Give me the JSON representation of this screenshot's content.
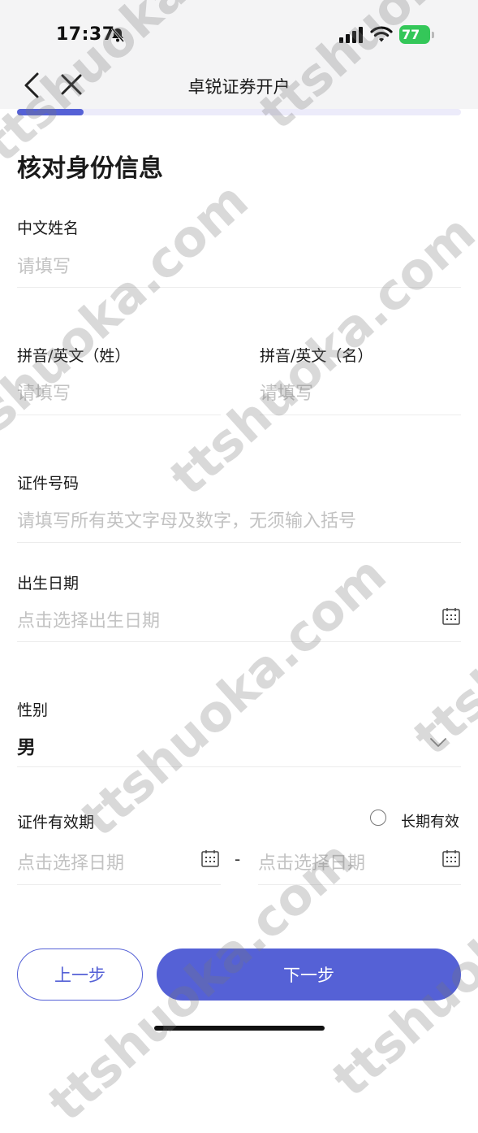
{
  "status_bar": {
    "time": "17:37",
    "battery": "77"
  },
  "nav": {
    "title": "卓锐证券开户"
  },
  "progress": {
    "fraction": 0.15
  },
  "page_title": "核对身份信息",
  "form": {
    "chinese_name": {
      "label": "中文姓名",
      "placeholder": "请填写"
    },
    "pinyin_surname": {
      "label": "拼音/英文（姓）",
      "placeholder": "请填写"
    },
    "pinyin_given": {
      "label": "拼音/英文（名）",
      "placeholder": "请填写"
    },
    "id_number": {
      "label": "证件号码",
      "placeholder": "请填写所有英文字母及数字，无须输入括号"
    },
    "birth_date": {
      "label": "出生日期",
      "placeholder": "点击选择出生日期"
    },
    "gender": {
      "label": "性别",
      "value": "男"
    },
    "validity": {
      "label": "证件有效期",
      "long_term_label": "长期有效",
      "start_placeholder": "点击选择日期",
      "separator": "-",
      "end_placeholder": "点击选择日期"
    }
  },
  "buttons": {
    "prev": "上一步",
    "next": "下一步"
  },
  "watermark": "ttshuoka.com",
  "colors": {
    "accent": "#5561d6",
    "battery": "#34c759"
  },
  "icons": [
    "back-icon",
    "close-icon",
    "calendar-icon",
    "chevron-down-icon",
    "bell-slash-icon",
    "signal-icon",
    "wifi-icon",
    "battery-icon"
  ]
}
